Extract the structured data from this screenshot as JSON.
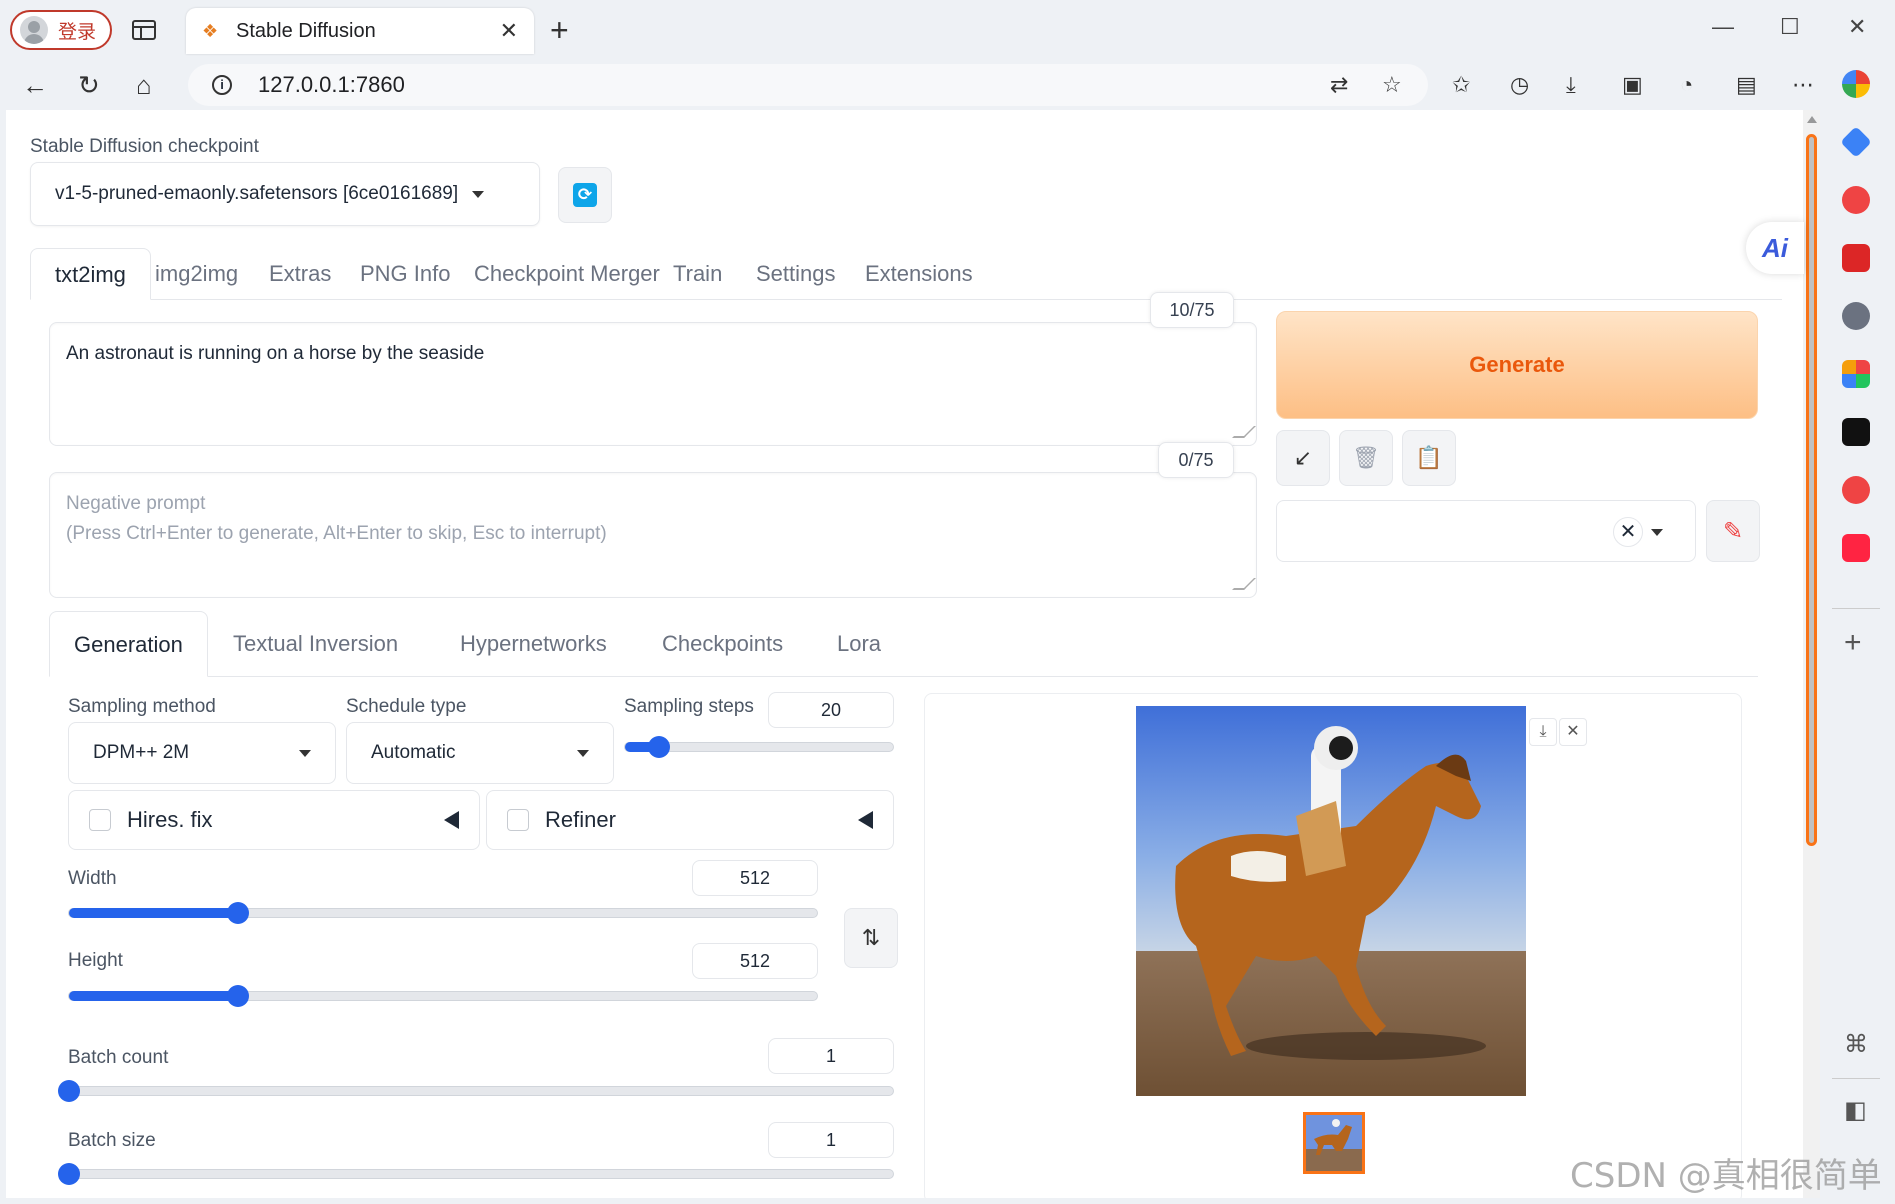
{
  "browser": {
    "profile_label": "登录",
    "tab_title": "Stable Diffusion",
    "url": "127.0.0.1:7860"
  },
  "checkpoint": {
    "label": "Stable Diffusion checkpoint",
    "value": "v1-5-pruned-emaonly.safetensors [6ce0161689]"
  },
  "main_tabs": [
    "txt2img",
    "img2img",
    "Extras",
    "PNG Info",
    "Checkpoint Merger",
    "Train",
    "Settings",
    "Extensions"
  ],
  "prompt": {
    "text": "An astronaut is running on a horse by the seaside",
    "counter": "10/75"
  },
  "negative_prompt": {
    "placeholder_line1": "Negative prompt",
    "placeholder_line2": "(Press Ctrl+Enter to generate, Alt+Enter to skip, Esc to interrupt)",
    "counter": "0/75"
  },
  "generate_label": "Generate",
  "ai_badge": "Ai",
  "sub_tabs": [
    "Generation",
    "Textual Inversion",
    "Hypernetworks",
    "Checkpoints",
    "Lora"
  ],
  "sampling": {
    "method_label": "Sampling method",
    "method_value": "DPM++ 2M",
    "schedule_label": "Schedule type",
    "schedule_value": "Automatic",
    "steps_label": "Sampling steps",
    "steps_value": "20",
    "steps_min": 1,
    "steps_max": 150
  },
  "hires_label": "Hires. fix",
  "refiner_label": "Refiner",
  "width": {
    "label": "Width",
    "value": "512",
    "min": 64,
    "max": 2048
  },
  "height": {
    "label": "Height",
    "value": "512",
    "min": 64,
    "max": 2048
  },
  "batch_count": {
    "label": "Batch count",
    "value": "1",
    "min": 1,
    "max": 100
  },
  "batch_size": {
    "label": "Batch size",
    "value": "1",
    "min": 1,
    "max": 8
  },
  "watermark": "CSDN @真相很简单",
  "colors": {
    "accent": "#2563eb",
    "generate_text": "#ea580c",
    "profile": "#c0392b"
  }
}
